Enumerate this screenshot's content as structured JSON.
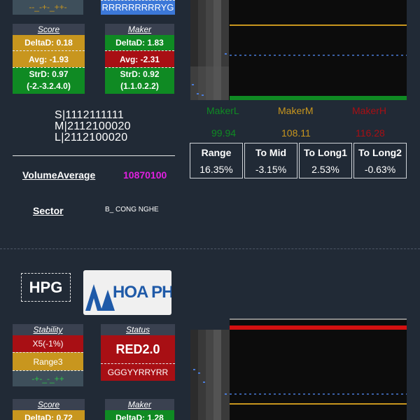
{
  "top_section": {
    "stability_bottom_text": "--_-+-_++-",
    "status_bottom_text": "RRRRRRRRRYG",
    "score_card": {
      "header": "Score",
      "rows": [
        "DeltaD: 0.18",
        "Avg: -1.93",
        "StrD: 0.97",
        "(-2.-3.2.4.0)"
      ]
    },
    "maker_card": {
      "header": "Maker",
      "rows": [
        "DeltaD: 1.83",
        "Avg: -2.31",
        "StrD: 0.92",
        "(1.1.0.2.2)"
      ]
    },
    "sml_codes": [
      "S|1112111111",
      "M|2112100020",
      "L|2112100020"
    ],
    "volume_average_label": "VolumeAverage",
    "volume_average_value": "10870100",
    "sector_label": "Sector",
    "sector_value": "B_ CONG NGHE",
    "makers": [
      {
        "label": "MakerL",
        "value": "99.94",
        "color": "#0f8a23"
      },
      {
        "label": "MakerM",
        "value": "108.11",
        "color": "#c8961e"
      },
      {
        "label": "MakerH",
        "value": "116.28",
        "color": "#a80f14"
      }
    ],
    "range_table": [
      {
        "header": "Range",
        "value": "16.35%"
      },
      {
        "header": "To Mid",
        "value": "-3.15%"
      },
      {
        "header": "To Long1",
        "value": "2.53%"
      },
      {
        "header": "To Long2",
        "value": "-0.63%"
      }
    ]
  },
  "bottom_section": {
    "ticker": "HPG",
    "logo_text": "HOA PHAT",
    "stability_card": {
      "header": "Stability",
      "rows": [
        "X5(-1%)",
        "Range3",
        "-+-_-_++"
      ]
    },
    "status_card": {
      "header": "Status",
      "main": "RED2.0",
      "sub": "GGGYYRRYRR"
    },
    "score_card": {
      "header": "Score",
      "first_row": "DeltaD: 0.72"
    },
    "maker_card": {
      "header": "Maker",
      "first_row": "DeltaD: 1.28"
    }
  },
  "colors": {
    "background": "#212a36",
    "gold": "#c8961e",
    "green": "#0f8a23",
    "red": "#a80f14",
    "magenta": "#e020e0",
    "status_blue": "#3c78d8"
  }
}
